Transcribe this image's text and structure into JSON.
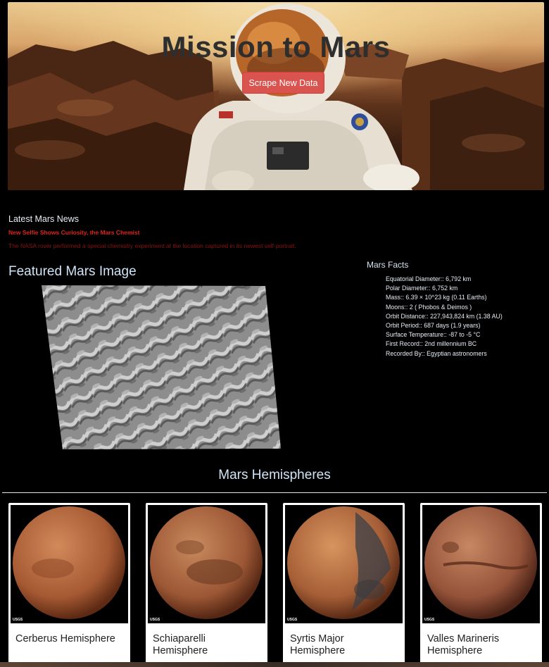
{
  "hero": {
    "title": "Mission to Mars",
    "scrape_button": "Scrape New Data"
  },
  "news": {
    "heading": "Latest Mars News",
    "title": "New Selfie Shows Curiosity, the Mars Chemist",
    "teaser": "The NASA rover performed a special chemistry experiment at the location captured in its newest self-portrait."
  },
  "featured": {
    "heading": "Featured Mars Image"
  },
  "facts": {
    "heading": "Mars Facts",
    "items": [
      "Equatorial Diameter:: 6,792 km",
      "Polar Diameter:: 6,752 km",
      "Mass:: 6.39 × 10^23 kg (0.11 Earths)",
      "Moons:: 2 ( Phobos & Deimos )",
      "Orbit Distance:: 227,943,824 km (1.38 AU)",
      "Orbit Period:: 687 days (1.9 years)",
      "Surface Temperature:: -87 to -5 °C",
      "First Record:: 2nd millennium BC",
      "Recorded By:: Egyptian astronomers"
    ]
  },
  "hemispheres": {
    "heading": "Mars Hemispheres",
    "cards": [
      {
        "title": "Cerberus Hemisphere",
        "credit": "USGS"
      },
      {
        "title": "Schiaparelli Hemisphere",
        "credit": "USGS"
      },
      {
        "title": "Syrtis Major Hemisphere",
        "credit": "USGS"
      },
      {
        "title": "Valles Marineris Hemisphere",
        "credit": "USGS"
      }
    ]
  },
  "colors": {
    "background": "#000000",
    "button": "#d9534f",
    "news_title": "#e0241b",
    "heading_text": "#cfe3f7"
  }
}
